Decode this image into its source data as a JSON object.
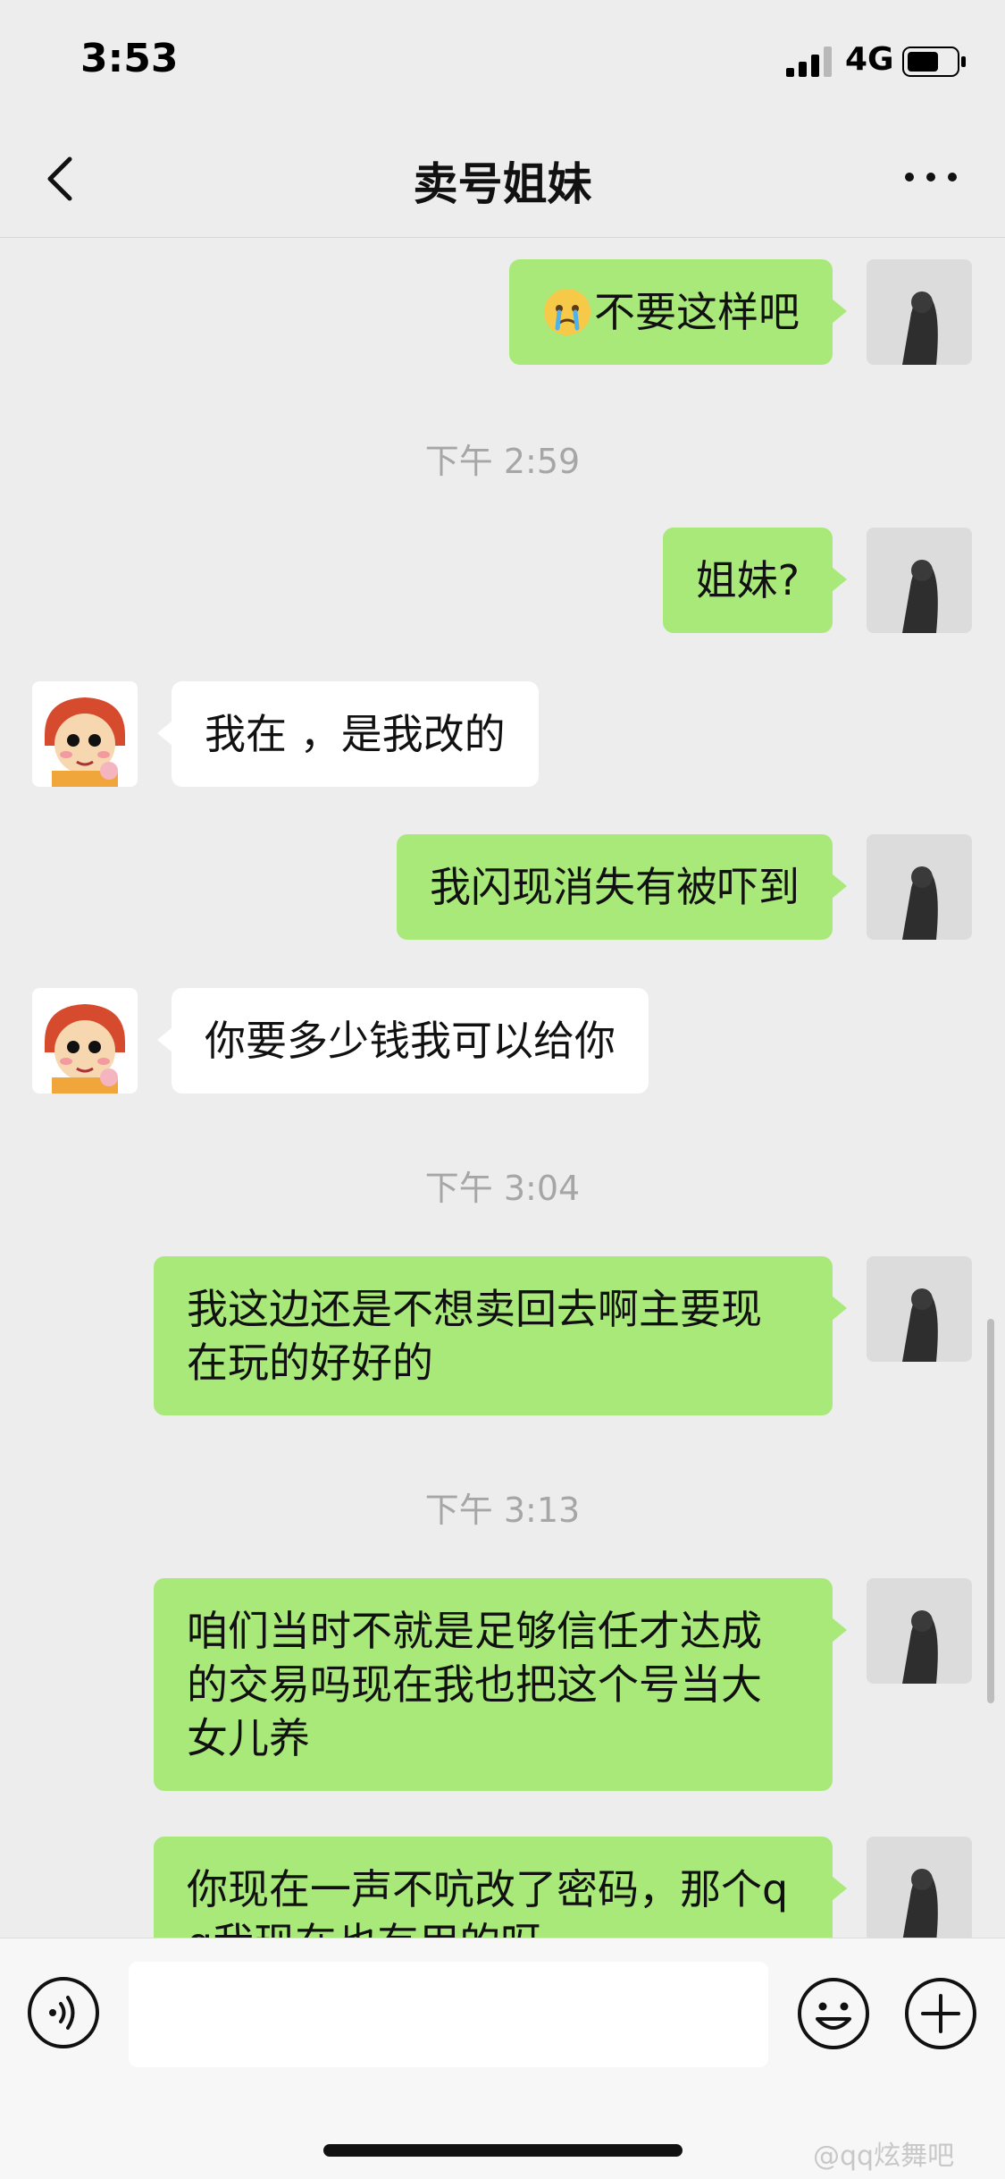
{
  "status_bar": {
    "time": "3:53",
    "network": "4G"
  },
  "nav": {
    "title": "卖号姐妹"
  },
  "messages": [
    {
      "side": "me",
      "emoji": "crying-face",
      "text": "不要这样吧"
    },
    {
      "timestamp": "下午 2:59"
    },
    {
      "side": "me",
      "text": "姐妹?"
    },
    {
      "side": "other",
      "text": "我在 ，是我改的"
    },
    {
      "side": "me",
      "text": "我闪现消失有被吓到"
    },
    {
      "side": "other",
      "text": "你要多少钱我可以给你"
    },
    {
      "timestamp": "下午 3:04"
    },
    {
      "side": "me",
      "text": "我这边还是不想卖回去啊主要现在玩的好好的"
    },
    {
      "timestamp": "下午 3:13"
    },
    {
      "side": "me",
      "text": "咱们当时不就是足够信任才达成的交易吗现在我也把这个号当大女儿养"
    },
    {
      "side": "me",
      "text": "你现在一声不吭改了密码，那个qq我现在也有用的呀"
    }
  ],
  "input_bar": {
    "placeholder": ""
  },
  "watermark": "@qq炫舞吧",
  "colors": {
    "my_bubble": "#a9e97a",
    "their_bubble": "#ffffff",
    "background": "#ededed"
  }
}
